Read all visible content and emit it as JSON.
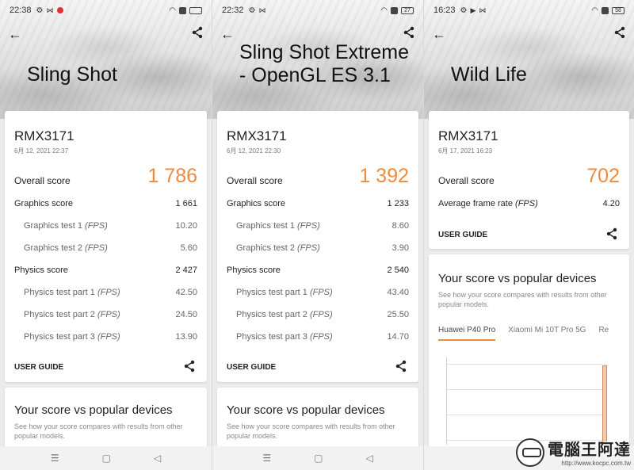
{
  "panels": [
    {
      "status": {
        "time": "22:38",
        "battery": ""
      },
      "title": "Sling Shot",
      "device": "RMX3171",
      "date": "6月 12, 2021 22:37",
      "overall_label": "Overall score",
      "overall_value": "1 786",
      "rows": [
        {
          "label": "Graphics score",
          "value": "1 661"
        },
        {
          "label": "Graphics test 1",
          "fps": "(FPS)",
          "value": "10.20"
        },
        {
          "label": "Graphics test 2",
          "fps": "(FPS)",
          "value": "5.60"
        },
        {
          "label": "Physics score",
          "value": "2 427"
        },
        {
          "label": "Physics test part 1",
          "fps": "(FPS)",
          "value": "42.50"
        },
        {
          "label": "Physics test part 2",
          "fps": "(FPS)",
          "value": "24.50"
        },
        {
          "label": "Physics test part 3",
          "fps": "(FPS)",
          "value": "13.90"
        }
      ],
      "user_guide": "USER GUIDE",
      "popular_title": "Your score vs popular devices",
      "popular_desc": "See how your score compares with results from other popular models."
    },
    {
      "status": {
        "time": "22:32",
        "battery": "27"
      },
      "title": "Sling Shot Extreme - OpenGL ES 3.1",
      "device": "RMX3171",
      "date": "6月 12, 2021 22:30",
      "overall_label": "Overall score",
      "overall_value": "1 392",
      "rows": [
        {
          "label": "Graphics score",
          "value": "1 233"
        },
        {
          "label": "Graphics test 1",
          "fps": "(FPS)",
          "value": "8.60"
        },
        {
          "label": "Graphics test 2",
          "fps": "(FPS)",
          "value": "3.90"
        },
        {
          "label": "Physics score",
          "value": "2 540"
        },
        {
          "label": "Physics test part 1",
          "fps": "(FPS)",
          "value": "43.40"
        },
        {
          "label": "Physics test part 2",
          "fps": "(FPS)",
          "value": "25.50"
        },
        {
          "label": "Physics test part 3",
          "fps": "(FPS)",
          "value": "14.70"
        }
      ],
      "user_guide": "USER GUIDE",
      "popular_title": "Your score vs popular devices",
      "popular_desc": "See how your score compares with results from other popular models."
    },
    {
      "status": {
        "time": "16:23",
        "battery": "58"
      },
      "title": "Wild Life",
      "device": "RMX3171",
      "date": "6月 17, 2021 16:23",
      "overall_label": "Overall score",
      "overall_value": "702",
      "avg_label": "Average frame rate",
      "avg_fps": "(FPS)",
      "avg_value": "4.20",
      "user_guide": "USER GUIDE",
      "popular_title": "Your score vs popular devices",
      "popular_desc": "See how your score compares with results from other popular models.",
      "tabs": [
        "Huawei P40 Pro",
        "Xiaomi Mi 10T Pro 5G",
        "Re"
      ]
    }
  ],
  "watermark": {
    "main": "電腦王阿達",
    "url": "http://www.kocpc.com.tw"
  },
  "colors": {
    "accent": "#f08a3c",
    "tab_underline": "#f08a3c",
    "chart_bar": "#f4c9a8"
  }
}
